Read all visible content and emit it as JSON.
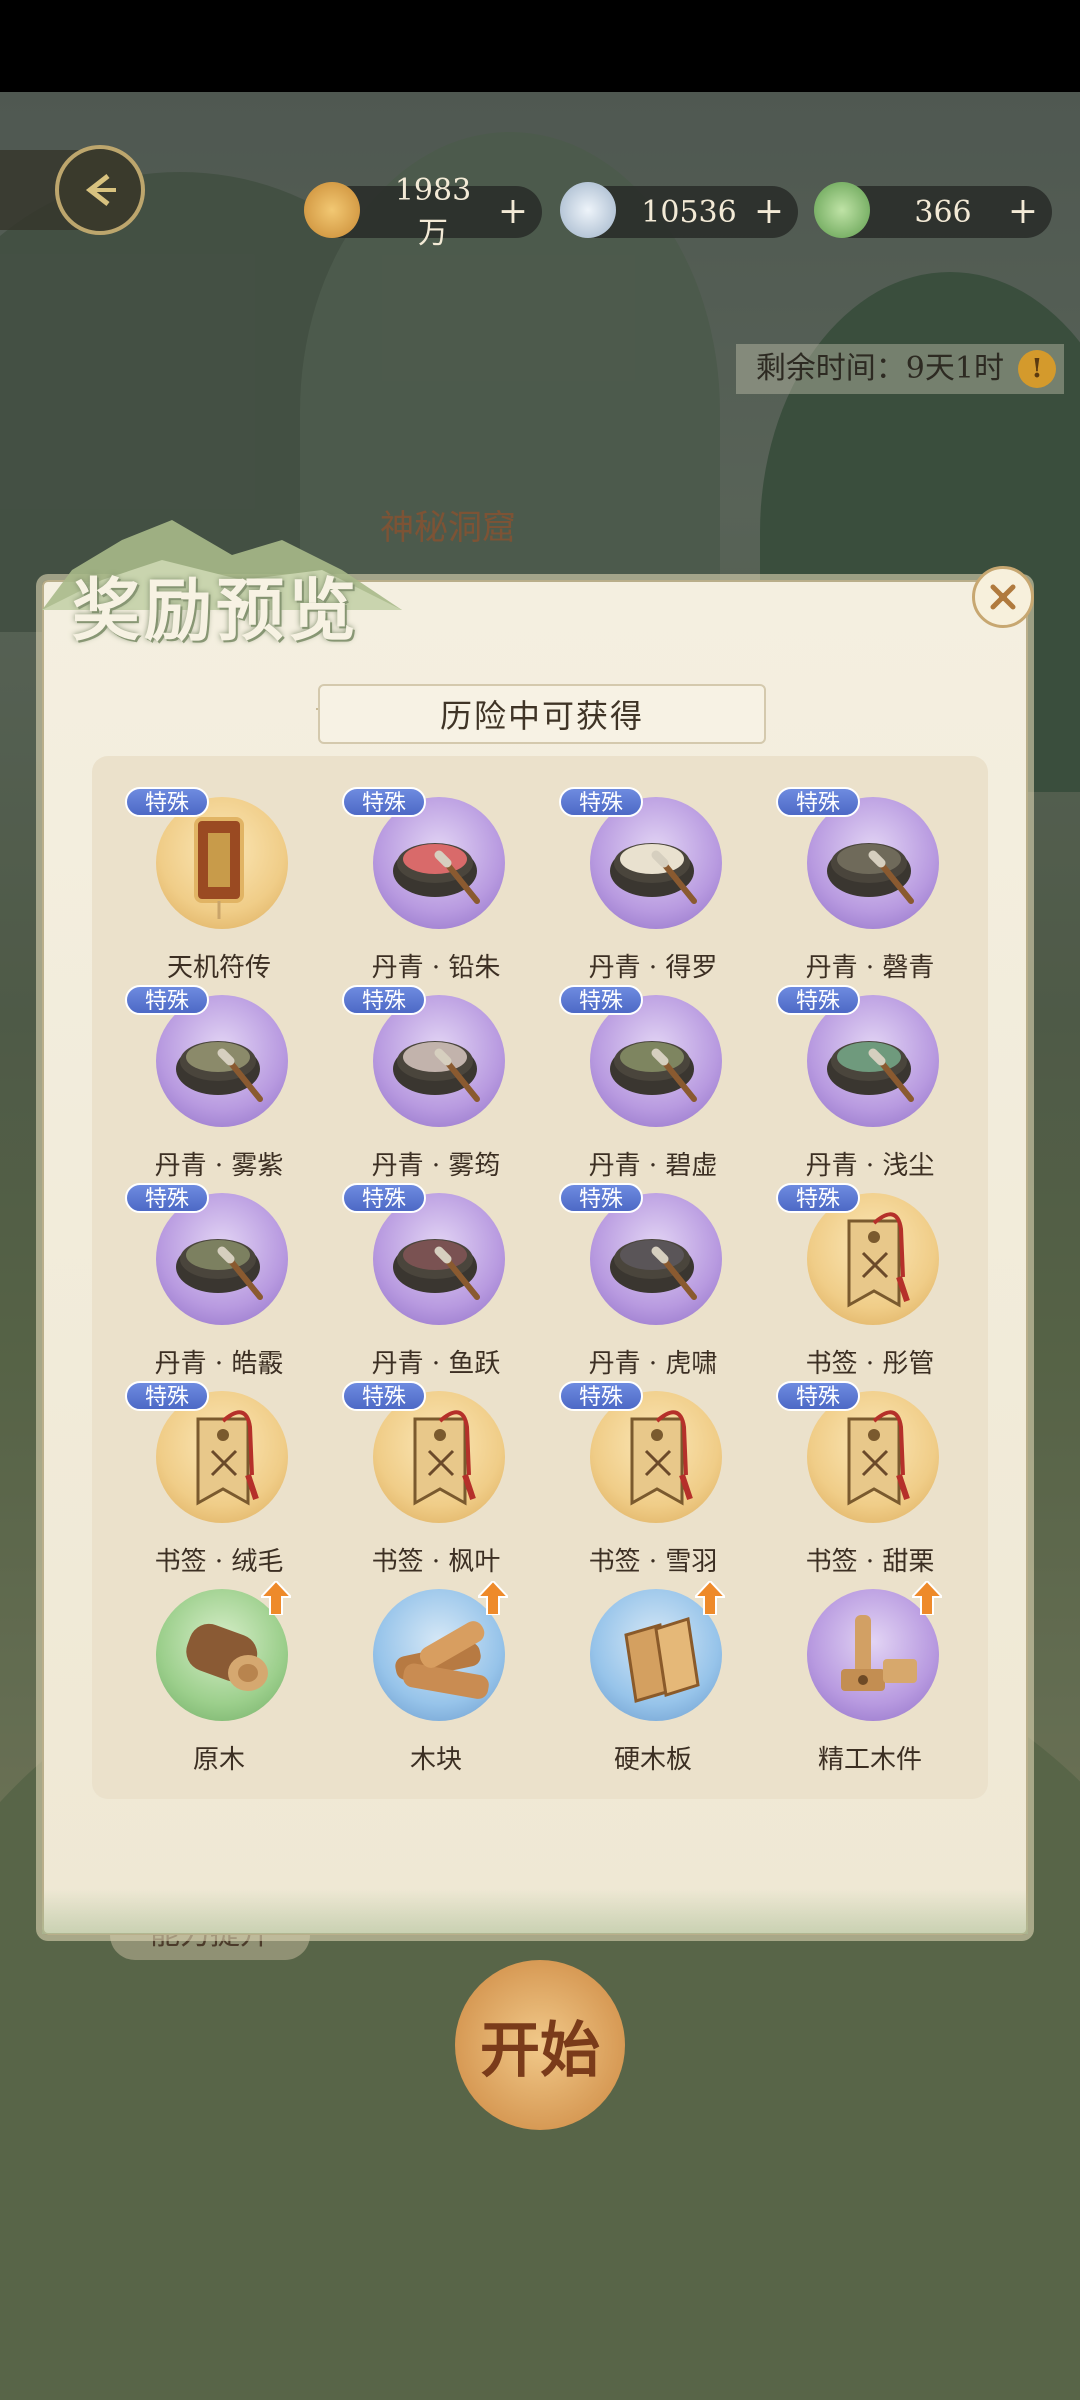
{
  "currencies": [
    {
      "name": "coin",
      "value": "1983万",
      "plus": "+",
      "color": "#d9a24a"
    },
    {
      "name": "silver",
      "value": "10536",
      "plus": "+",
      "color": "#b9c9d9"
    },
    {
      "name": "jade",
      "value": "366",
      "plus": "+",
      "color": "#7bbf6a"
    }
  ],
  "timer": {
    "text": "剩余时间：9天1时",
    "warn": "!"
  },
  "scene": {
    "cave_label": "神秘洞窟",
    "start_label": "开始",
    "ability_label": "能力提升"
  },
  "panel": {
    "title": "奖励预览",
    "subtitle": "历险中可获得",
    "tag_text": "特殊",
    "items": [
      {
        "label": "天机符传",
        "tag": true,
        "orb": "gold",
        "art": "talisman"
      },
      {
        "label": "丹青 · 铅朱",
        "tag": true,
        "orb": "purple",
        "art": "ink",
        "ink": "#d96a6a"
      },
      {
        "label": "丹青 · 得罗",
        "tag": true,
        "orb": "purple",
        "art": "ink",
        "ink": "#e9e1cf"
      },
      {
        "label": "丹青 · 磬青",
        "tag": true,
        "orb": "purple",
        "art": "ink",
        "ink": "#6f6a5a"
      },
      {
        "label": "丹青 · 雾紫",
        "tag": true,
        "orb": "purple",
        "art": "ink",
        "ink": "#8b8a6a"
      },
      {
        "label": "丹青 · 雾筠",
        "tag": true,
        "orb": "purple",
        "art": "ink",
        "ink": "#c2b3ac"
      },
      {
        "label": "丹青 · 碧虚",
        "tag": true,
        "orb": "purple",
        "art": "ink",
        "ink": "#7e8560"
      },
      {
        "label": "丹青 · 浅尘",
        "tag": true,
        "orb": "purple",
        "art": "ink",
        "ink": "#6f9a7d"
      },
      {
        "label": "丹青 · 皓霰",
        "tag": true,
        "orb": "purple",
        "art": "ink",
        "ink": "#7c8060"
      },
      {
        "label": "丹青 · 鱼跃",
        "tag": true,
        "orb": "purple",
        "art": "ink",
        "ink": "#7a5252"
      },
      {
        "label": "丹青 · 虎啸",
        "tag": true,
        "orb": "purple",
        "art": "ink",
        "ink": "#5a5558"
      },
      {
        "label": "书签 · 彤管",
        "tag": true,
        "orb": "gold",
        "art": "bookmark"
      },
      {
        "label": "书签 · 绒毛",
        "tag": true,
        "orb": "gold",
        "art": "bookmark"
      },
      {
        "label": "书签 · 枫叶",
        "tag": true,
        "orb": "gold",
        "art": "bookmark"
      },
      {
        "label": "书签 · 雪羽",
        "tag": true,
        "orb": "gold",
        "art": "bookmark"
      },
      {
        "label": "书签 · 甜栗",
        "tag": true,
        "orb": "gold",
        "art": "bookmark"
      },
      {
        "label": "原木",
        "tag": false,
        "upgrade": true,
        "orb": "green",
        "art": "log"
      },
      {
        "label": "木块",
        "tag": false,
        "upgrade": true,
        "orb": "blue",
        "art": "planks"
      },
      {
        "label": "硬木板",
        "tag": false,
        "upgrade": true,
        "orb": "blue",
        "art": "boards"
      },
      {
        "label": "精工木件",
        "tag": false,
        "upgrade": true,
        "orb": "purple",
        "art": "woodparts"
      }
    ]
  }
}
